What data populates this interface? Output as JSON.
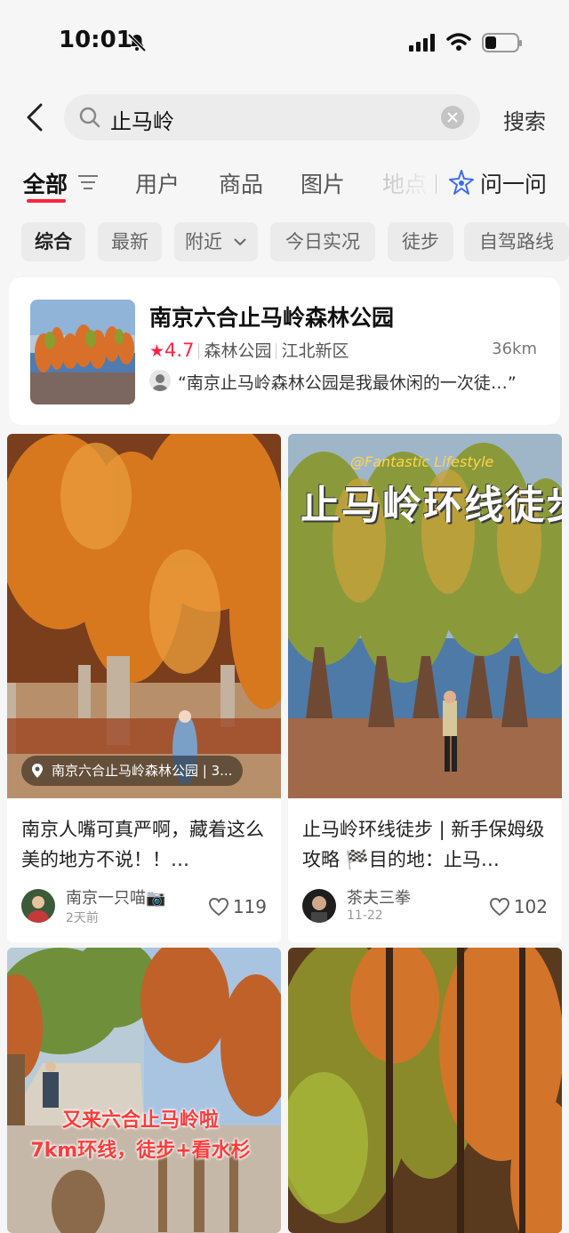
{
  "status_bar": {
    "time": "10:01"
  },
  "search": {
    "back_icon": "chevron-left-icon",
    "query": "止马岭",
    "submit_label": "搜索"
  },
  "tabs": {
    "items": [
      {
        "label": "全部"
      },
      {
        "label": "用户"
      },
      {
        "label": "商品"
      },
      {
        "label": "图片"
      },
      {
        "label": "地点"
      }
    ],
    "ask_label": "问一问",
    "accent": "#ff2442"
  },
  "chips": [
    "综合",
    "最新",
    "附近",
    "今日实况",
    "徒步",
    "自驾路线"
  ],
  "poi": {
    "name": "南京六合止马岭森林公园",
    "star": "★",
    "rating": "4.7",
    "category": "森林公园",
    "area": "江北新区",
    "distance": "36km",
    "quote": "“南京止马岭森林公园是我最休闲的一次徒…”"
  },
  "feed": [
    {
      "title": "南京人嘴可真严啊，藏着这么美的地方不说！！…",
      "location": "南京六合止马岭森林公园 | 3...",
      "user": "南京一只喵📷",
      "time": "2天前",
      "likes": "119"
    },
    {
      "title": "止马岭环线徒步 | 新手保姆级攻略 🏁目的地：止马…",
      "overlay_sub": "@Fantastic Lifestyle",
      "overlay_title": "止马岭环线徒步",
      "user": "茶夫三拳",
      "time": "11-22",
      "likes": "102"
    },
    {
      "overlay_line1": "又来六合止马岭啦",
      "overlay_line2": "7km环线，徒步+看水杉"
    },
    {}
  ]
}
